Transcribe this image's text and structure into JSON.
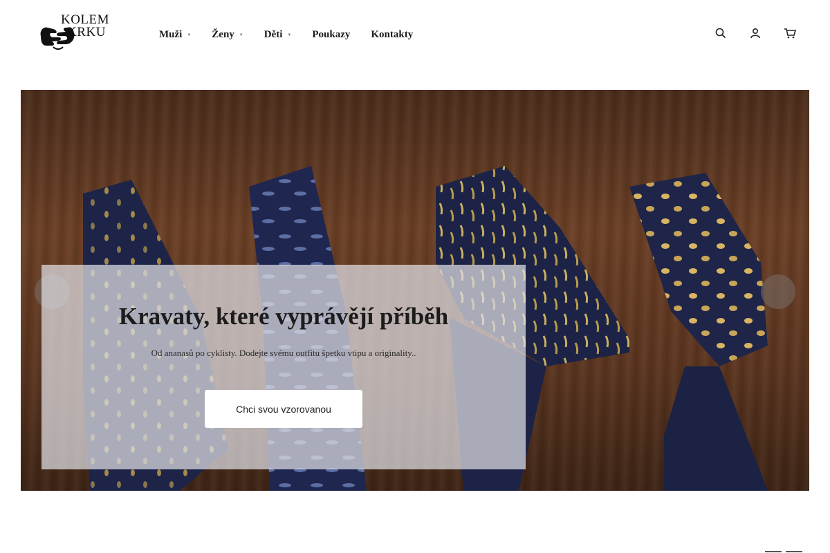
{
  "header": {
    "logo": {
      "line1": "KOLEM",
      "line2": "KRKU"
    },
    "nav": [
      {
        "label": "Muži",
        "has_dropdown": true
      },
      {
        "label": "Ženy",
        "has_dropdown": true
      },
      {
        "label": "Děti",
        "has_dropdown": true
      },
      {
        "label": "Poukazy",
        "has_dropdown": false
      },
      {
        "label": "Kontakty",
        "has_dropdown": false
      }
    ],
    "icons": [
      "search-icon",
      "user-icon",
      "cart-icon"
    ]
  },
  "hero": {
    "title": "Kravaty, které vyprávějí příběh",
    "subtitle": "Od ananasů po cyklisty. Dodejte svému outfitu špetku vtipu a originality..",
    "cta_label": "Chci svou vzorovanou",
    "arrow_left_glyph": "",
    "arrow_right_glyph": ""
  },
  "colors": {
    "wood": "#5a341f",
    "tie_navy": "#1e2447",
    "overlay": "#e1e1e6",
    "text_dark": "#1a1a1a"
  }
}
